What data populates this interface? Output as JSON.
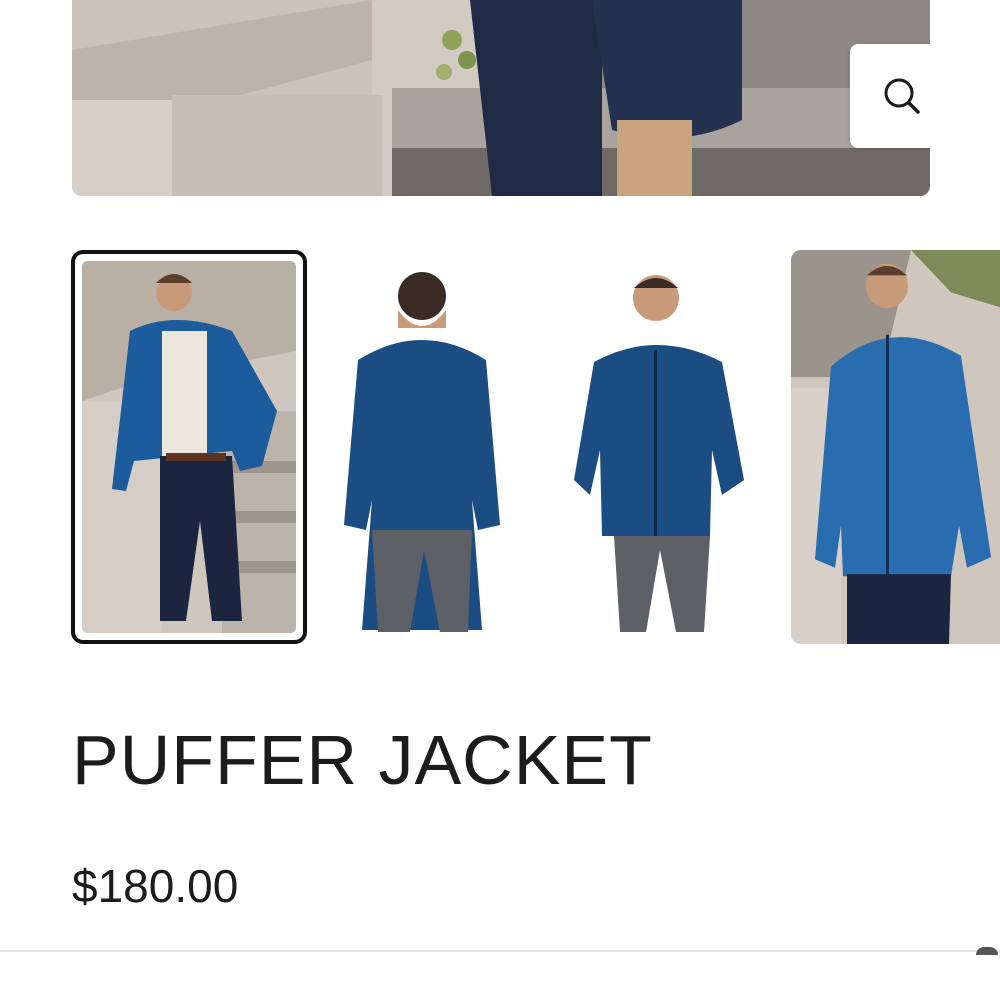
{
  "gallery": {
    "zoom_icon": "magnifier-icon",
    "thumbnails": [
      {
        "selected": true
      },
      {
        "selected": false
      },
      {
        "selected": false
      },
      {
        "selected": false
      }
    ]
  },
  "product": {
    "title": "PUFFER JACKET",
    "price": "$180.00"
  },
  "colors": {
    "jacket": "#1d4f86",
    "text": "#1c1c1c",
    "selected_border": "#111111"
  }
}
